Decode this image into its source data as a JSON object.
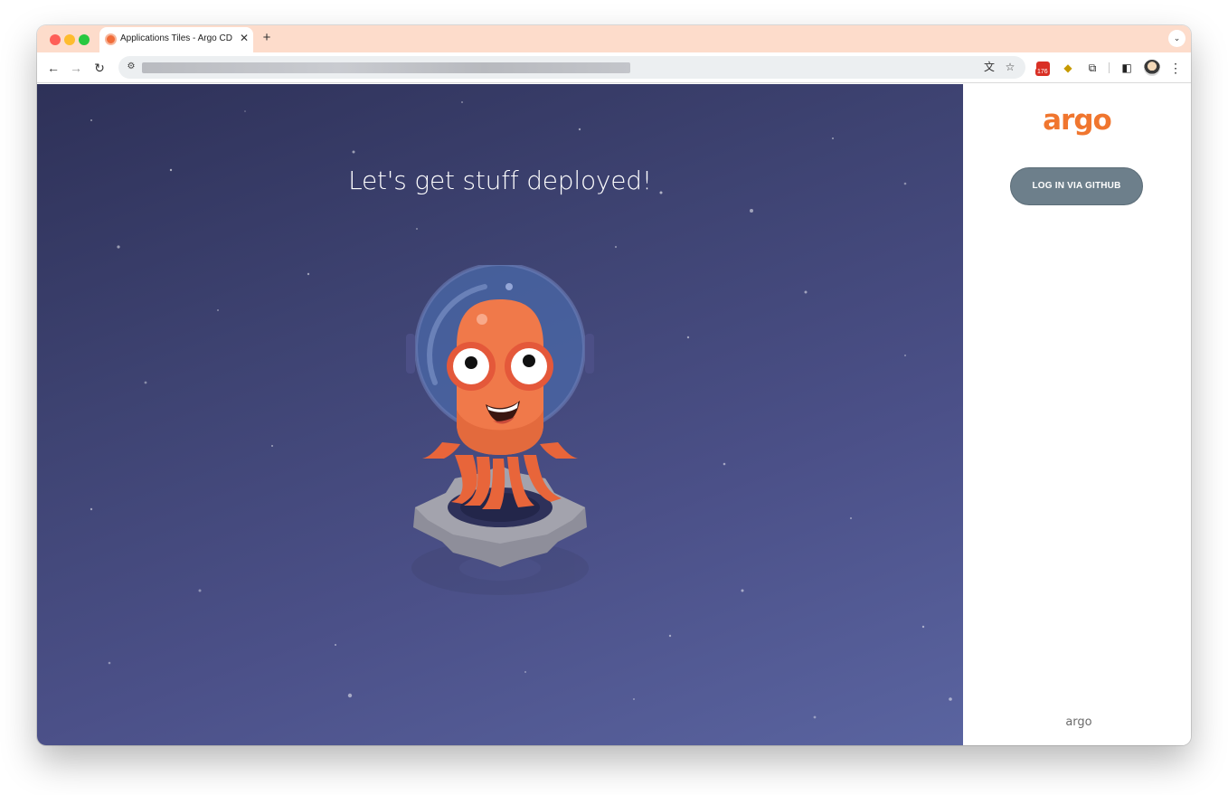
{
  "browser": {
    "tab_title": "Applications Tiles - Argo CD",
    "tab_close_glyph": "✕",
    "new_tab_glyph": "+",
    "tab_menu_glyph": "⌄",
    "back_glyph": "←",
    "forward_glyph": "→",
    "reload_glyph": "↻",
    "site_info_glyph": "⚙",
    "translate_glyph": "文",
    "bookmark_glyph": "☆",
    "extension_badge_count": "176",
    "extensions_glyph": "⧉",
    "sidepanel_glyph": "◧",
    "menu_glyph": "⋮",
    "icons": [
      "back-icon",
      "forward-icon",
      "reload-icon",
      "site-info-icon",
      "translate-icon",
      "bookmark-star-icon",
      "extension-icon",
      "puzzle-icon",
      "side-panel-icon",
      "profile-avatar",
      "more-menu-icon"
    ]
  },
  "hero": {
    "title": "Let's get stuff deployed!"
  },
  "login": {
    "logo_text": "argo",
    "github_button": "LOG IN VIA GITHUB",
    "footer_logo": "argo"
  },
  "colors": {
    "accent_orange": "#f0762f",
    "button_gray": "#6d7f8b",
    "tabstrip": "#fddccb"
  }
}
